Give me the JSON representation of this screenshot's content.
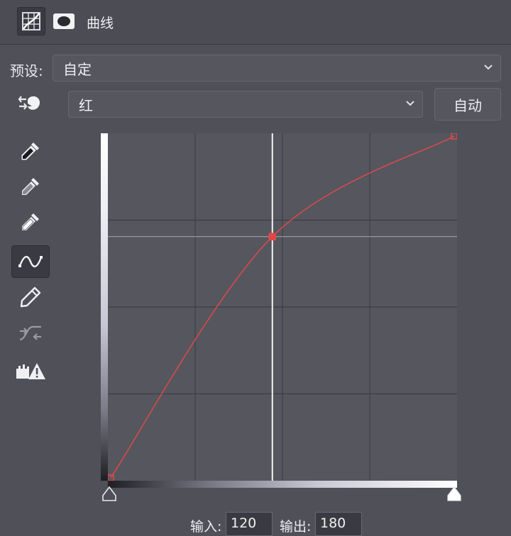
{
  "header": {
    "title": "曲线",
    "icons": [
      "curves-adjustment-icon",
      "layer-mask-icon"
    ]
  },
  "preset": {
    "label": "预设:",
    "value": "自定"
  },
  "channel": {
    "value": "红"
  },
  "auto_button": {
    "label": "自动"
  },
  "tools": [
    "on-image-adjust-icon",
    "black-point-eyedropper-icon",
    "gray-point-eyedropper-icon",
    "white-point-eyedropper-icon",
    "curve-point-edit-icon",
    "pencil-draw-icon",
    "smooth-curve-icon",
    "clipping-warning-icon"
  ],
  "colors": {
    "curve": "#d94a4a",
    "point": "#e04848",
    "grid": "#3e3f46"
  },
  "curve": {
    "points": [
      [
        0,
        0
      ],
      [
        120,
        180
      ],
      [
        255,
        255
      ]
    ],
    "selected_point": [
      120,
      180
    ]
  },
  "io": {
    "input_label": "输入:",
    "input_value": "120",
    "output_label": "输出:",
    "output_value": "180"
  }
}
